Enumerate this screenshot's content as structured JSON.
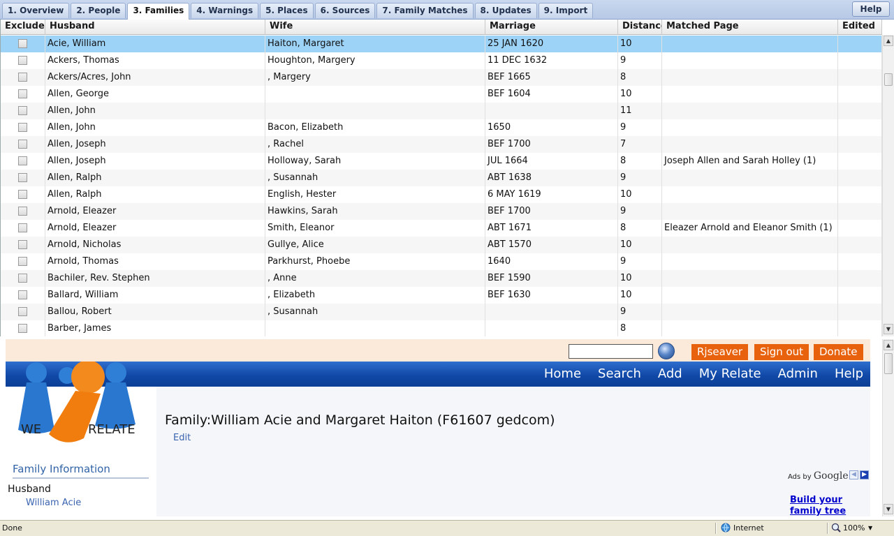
{
  "tabs": [
    {
      "label": "1. Overview",
      "active": false
    },
    {
      "label": "2. People",
      "active": false
    },
    {
      "label": "3. Families",
      "active": true
    },
    {
      "label": "4. Warnings",
      "active": false
    },
    {
      "label": "5. Places",
      "active": false
    },
    {
      "label": "6. Sources",
      "active": false
    },
    {
      "label": "7. Family Matches",
      "active": false
    },
    {
      "label": "8. Updates",
      "active": false
    },
    {
      "label": "9. Import",
      "active": false
    }
  ],
  "help_label": "Help",
  "grid": {
    "columns": [
      "Exclude",
      "Husband",
      "Wife",
      "Marriage",
      "Distance",
      "Matched Page",
      "Edited"
    ],
    "selected_row": 0,
    "rows": [
      {
        "husband": "Acie, William",
        "wife": "Haiton, Margaret",
        "marriage": "25 JAN 1620",
        "distance": "10",
        "matched": ""
      },
      {
        "husband": "Ackers, Thomas",
        "wife": "Houghton, Margery",
        "marriage": "11 DEC 1632",
        "distance": "9",
        "matched": ""
      },
      {
        "husband": "Ackers/Acres, John",
        "wife": ", Margery",
        "marriage": "BEF 1665",
        "distance": "8",
        "matched": ""
      },
      {
        "husband": "Allen, George",
        "wife": "",
        "marriage": "BEF 1604",
        "distance": "10",
        "matched": ""
      },
      {
        "husband": "Allen, John",
        "wife": "",
        "marriage": "",
        "distance": "11",
        "matched": ""
      },
      {
        "husband": "Allen, John",
        "wife": "Bacon, Elizabeth",
        "marriage": "1650",
        "distance": "9",
        "matched": ""
      },
      {
        "husband": "Allen, Joseph",
        "wife": ", Rachel",
        "marriage": "BEF 1700",
        "distance": "7",
        "matched": ""
      },
      {
        "husband": "Allen, Joseph",
        "wife": "Holloway, Sarah",
        "marriage": "JUL 1664",
        "distance": "8",
        "matched": "Joseph Allen and Sarah Holley (1)"
      },
      {
        "husband": "Allen, Ralph",
        "wife": ", Susannah",
        "marriage": "ABT 1638",
        "distance": "9",
        "matched": ""
      },
      {
        "husband": "Allen, Ralph",
        "wife": "English, Hester",
        "marriage": "6 MAY 1619",
        "distance": "10",
        "matched": ""
      },
      {
        "husband": "Arnold, Eleazer",
        "wife": "Hawkins, Sarah",
        "marriage": "BEF 1700",
        "distance": "9",
        "matched": ""
      },
      {
        "husband": "Arnold, Eleazer",
        "wife": "Smith, Eleanor",
        "marriage": "ABT 1671",
        "distance": "8",
        "matched": "Eleazer Arnold and Eleanor Smith (1)"
      },
      {
        "husband": "Arnold, Nicholas",
        "wife": "Gullye, Alice",
        "marriage": "ABT 1570",
        "distance": "10",
        "matched": ""
      },
      {
        "husband": "Arnold, Thomas",
        "wife": "Parkhurst, Phoebe",
        "marriage": "1640",
        "distance": "9",
        "matched": ""
      },
      {
        "husband": "Bachiler, Rev. Stephen",
        "wife": ", Anne",
        "marriage": "BEF 1590",
        "distance": "10",
        "matched": ""
      },
      {
        "husband": "Ballard, William",
        "wife": ", Elizabeth",
        "marriage": "BEF 1630",
        "distance": "10",
        "matched": ""
      },
      {
        "husband": "Ballou, Robert",
        "wife": ", Susannah",
        "marriage": "",
        "distance": "9",
        "matched": ""
      },
      {
        "husband": "Barber, James",
        "wife": "",
        "marriage": "",
        "distance": "8",
        "matched": ""
      }
    ]
  },
  "web": {
    "user_label": "Rjseaver",
    "signout_label": "Sign out",
    "donate_label": "Donate",
    "nav": [
      "Home",
      "Search",
      "Add",
      "My Relate",
      "Admin",
      "Help"
    ],
    "logo_text_left": "WE",
    "logo_text_right": "RELATE",
    "page_title": "Family:William Acie and Margaret Haiton (F61607 gedcom)",
    "edit_label": "Edit",
    "ads_by": "Ads by",
    "ads_google": "Google",
    "ad_link": "Build your family tree",
    "sidebar_heading": "Family Information",
    "husband_label": "Husband",
    "husband_name": "William Acie"
  },
  "status": {
    "text": "Done",
    "zone": "Internet",
    "zoom": "100%"
  },
  "colors": {
    "selected_row": "#9dd3f7",
    "nav_blue": "#1149a8",
    "orange_button": "#e8620e",
    "link_blue": "#3a63b0"
  }
}
